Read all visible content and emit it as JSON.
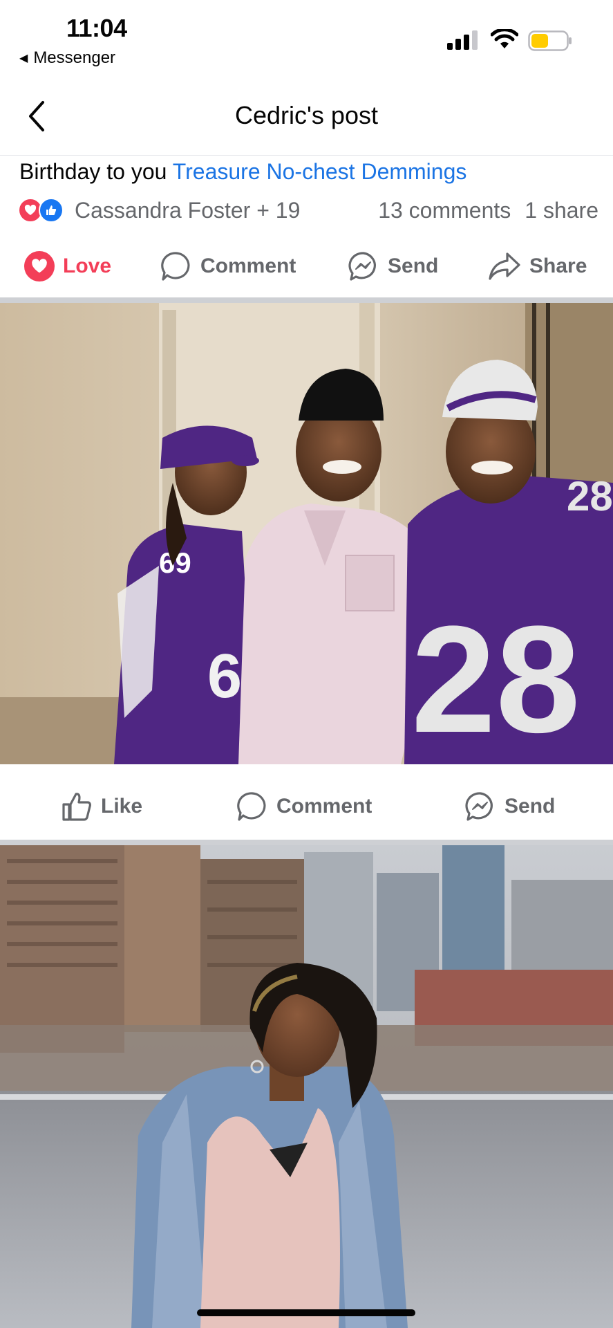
{
  "status_bar": {
    "time": "11:04",
    "back_app": "Messenger",
    "icons": [
      "cellular-signal-icon",
      "wifi-icon",
      "battery-icon"
    ],
    "battery_color": "#ffcc00"
  },
  "header": {
    "title": "Cedric's post",
    "back_icon": "chevron-left-icon"
  },
  "caption": {
    "text": "Birthday to you ",
    "mention": "Treasure No-chest Demmings"
  },
  "reactions": {
    "names": "Cassandra Foster + 19",
    "comments": "13 comments",
    "shares": "1 share",
    "icons": [
      "love-reaction-icon",
      "like-reaction-icon"
    ]
  },
  "post_actions": {
    "love": "Love",
    "comment": "Comment",
    "send": "Send",
    "share": "Share"
  },
  "photo_actions": {
    "like": "Like",
    "comment": "Comment",
    "send": "Send"
  },
  "colors": {
    "accent_blue": "#1b74e4",
    "love_red": "#f33e58",
    "secondary_text": "#65676b",
    "vikings_purple": "#4f2683"
  }
}
